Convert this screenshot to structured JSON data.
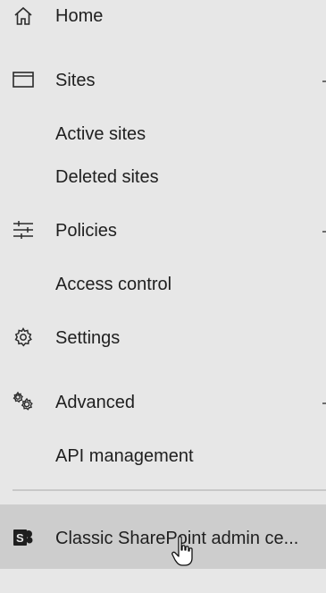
{
  "nav": {
    "home": {
      "label": "Home",
      "icon": "home-icon"
    },
    "sites": {
      "label": "Sites",
      "icon": "window-icon"
    },
    "active_sites": {
      "label": "Active sites"
    },
    "deleted_sites": {
      "label": "Deleted sites"
    },
    "policies": {
      "label": "Policies",
      "icon": "sliders-icon"
    },
    "access_control": {
      "label": "Access control"
    },
    "settings": {
      "label": "Settings",
      "icon": "gear-icon"
    },
    "advanced": {
      "label": "Advanced",
      "icon": "gears-icon"
    },
    "api_management": {
      "label": "API management"
    },
    "classic": {
      "label": "Classic SharePoint admin ce...",
      "icon": "sharepoint-icon"
    }
  },
  "colors": {
    "background": "#e7e7e7",
    "hover_background": "#cdcdcd",
    "sharepoint_brand": "#1f1f1f"
  }
}
